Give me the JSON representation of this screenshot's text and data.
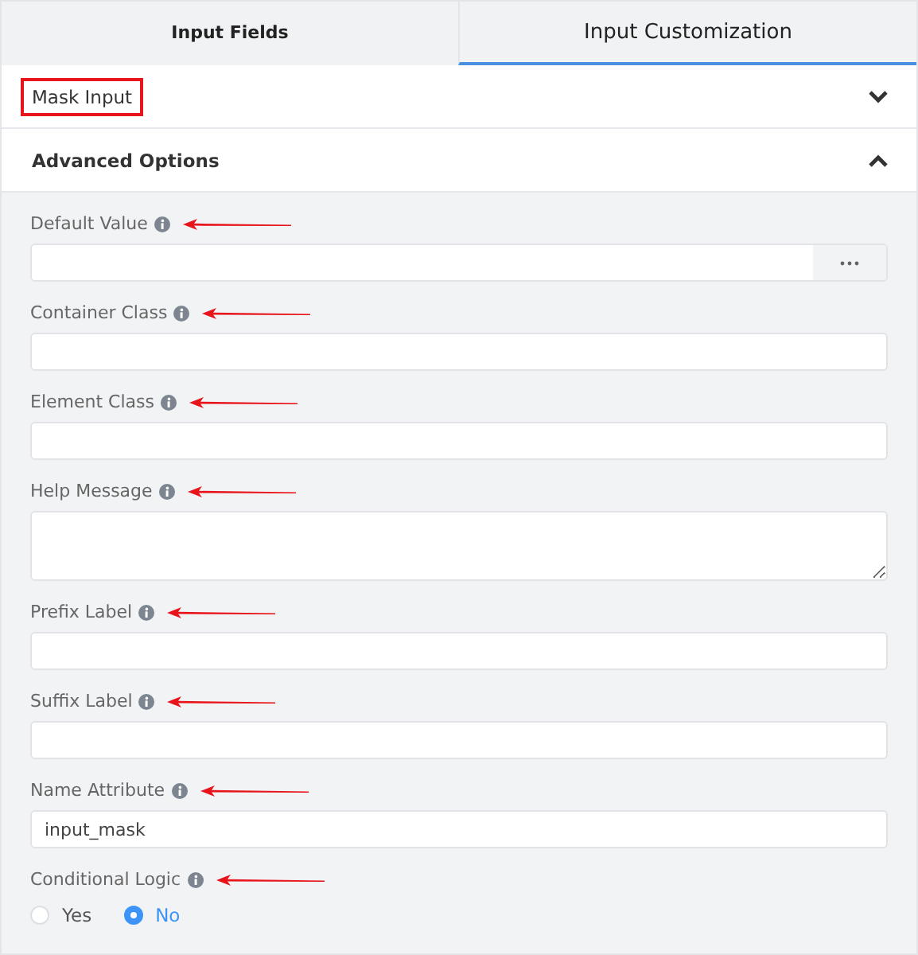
{
  "tabs": [
    {
      "label": "Input Fields",
      "selected": false
    },
    {
      "label": "Input Customization",
      "selected": true
    }
  ],
  "sections": [
    {
      "title": "Mask Input",
      "expanded": false,
      "highlighted": true
    },
    {
      "title": "Advanced Options",
      "expanded": true,
      "highlighted": false
    }
  ],
  "fields": [
    {
      "kind": "text-with-button",
      "label": "Default Value"
    },
    {
      "kind": "text",
      "label": "Container Class"
    },
    {
      "kind": "text",
      "label": "Element Class"
    },
    {
      "kind": "textarea",
      "label": "Help Message"
    },
    {
      "kind": "text",
      "label": "Prefix Label"
    },
    {
      "kind": "text",
      "label": "Suffix Label"
    },
    {
      "kind": "text",
      "label": "Name Attribute",
      "value": "input_mask"
    },
    {
      "kind": "radio",
      "label": "Conditional Logic",
      "options": [
        {
          "label": "Yes",
          "selected": false
        },
        {
          "label": "No",
          "selected": true
        }
      ]
    }
  ]
}
